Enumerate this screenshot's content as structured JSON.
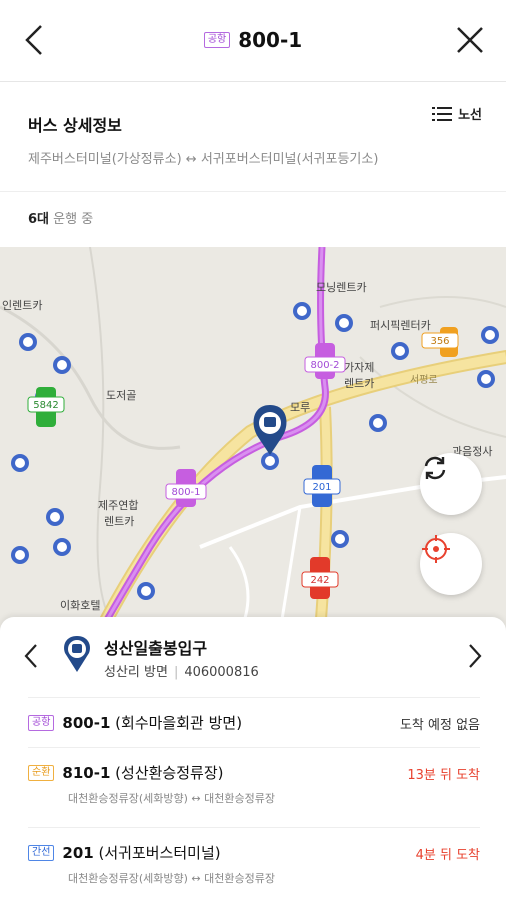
{
  "header": {
    "tag": "공항",
    "title": "800-1"
  },
  "info": {
    "title": "버스 상세정보",
    "route_list_label": "노선",
    "path": "제주버스터미널(가상정류소) ↔ 서귀포버스터미널(서귀포등기소)",
    "op_count": "6대",
    "op_suffix": "운행 중"
  },
  "map": {
    "labels": [
      "인렌트카",
      "모닝렌트카",
      "퍼시픽렌터카",
      "가자제",
      "렌트카",
      "도저골",
      "제주연합",
      "렌트카",
      "이화호텔",
      "과음정사",
      "서평로",
      "모루"
    ],
    "route_badges": [
      "5842",
      "356",
      "800-2",
      "800-1",
      "201",
      "242"
    ]
  },
  "stop": {
    "name": "성산일출봉입구",
    "direction": "성산리 방면",
    "code": "406000816"
  },
  "buses": [
    {
      "tag": "공항",
      "tag_color": "purple",
      "number": "800-1",
      "dest": "(회수마을회관 방면)",
      "eta": "도착 예정 없음",
      "eta_color": "normal",
      "path": ""
    },
    {
      "tag": "순환",
      "tag_color": "orange",
      "number": "810-1",
      "dest": "(성산환승정류장)",
      "eta": "13분 뒤 도착",
      "eta_color": "red",
      "path": "대천환승정류장(세화방향) ↔ 대천환승정류장"
    },
    {
      "tag": "간선",
      "tag_color": "blue",
      "number": "201",
      "dest": "(서귀포버스터미널)",
      "eta": "4분 뒤 도착",
      "eta_color": "red",
      "path": "대천환승정류장(세화방향) ↔ 대천환승정류장"
    }
  ]
}
